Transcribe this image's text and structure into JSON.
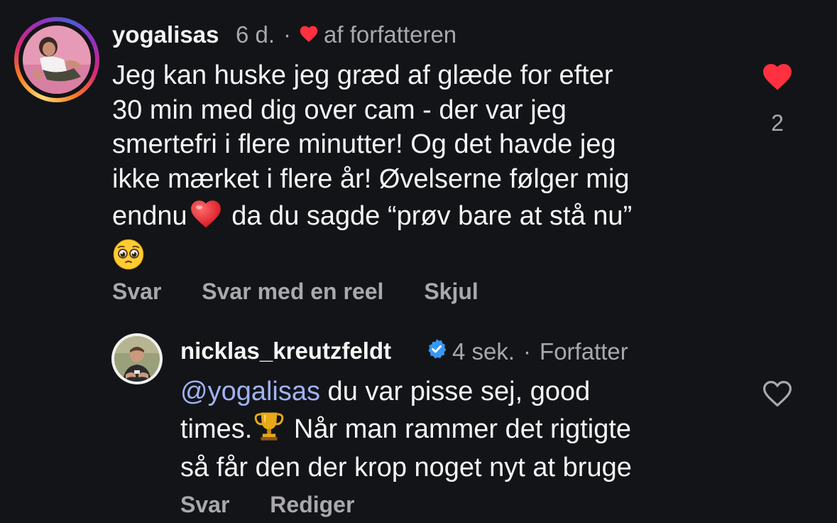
{
  "comments": [
    {
      "username": "yogalisas",
      "time": "6 d.",
      "separator": "·",
      "author_like_label": "af forfatteren",
      "text_lines": [
        "Jeg kan huske jeg græd af glæde for efter",
        "30 min med dig over cam - der var jeg",
        "smertefri i flere minutter! Og det havde jeg",
        "ikke mærket i flere år! Øvelserne følger mig",
        "endnu",
        " da du sagde “prøv bare at stå nu”"
      ],
      "emoji_names": [
        "red-heart-emoji",
        "pleading-face-emoji"
      ],
      "like_count": "2",
      "liked": true,
      "actions": [
        "Svar",
        "Svar med en reel",
        "Skjul"
      ]
    },
    {
      "username": "nicklas_kreutzfeldt",
      "verified": true,
      "time": "4 sek.",
      "separator": "·",
      "role_label": "Forfatter",
      "mention": "@yogalisas",
      "text_lines": [
        " du var pisse sej, good",
        "times.",
        " Når man rammer det rigtigte",
        "så får den der krop noget nyt at bruge"
      ],
      "emoji_names": [
        "trophy-emoji"
      ],
      "liked": false,
      "actions": [
        "Svar",
        "Rediger"
      ]
    }
  ],
  "colors": {
    "background": "#131417",
    "primary_text": "#f5f5f5",
    "secondary_text": "#a8a8ad",
    "like_red": "#ff3040",
    "mention_blue": "#9fb3f5",
    "verified_blue": "#3897f0"
  }
}
